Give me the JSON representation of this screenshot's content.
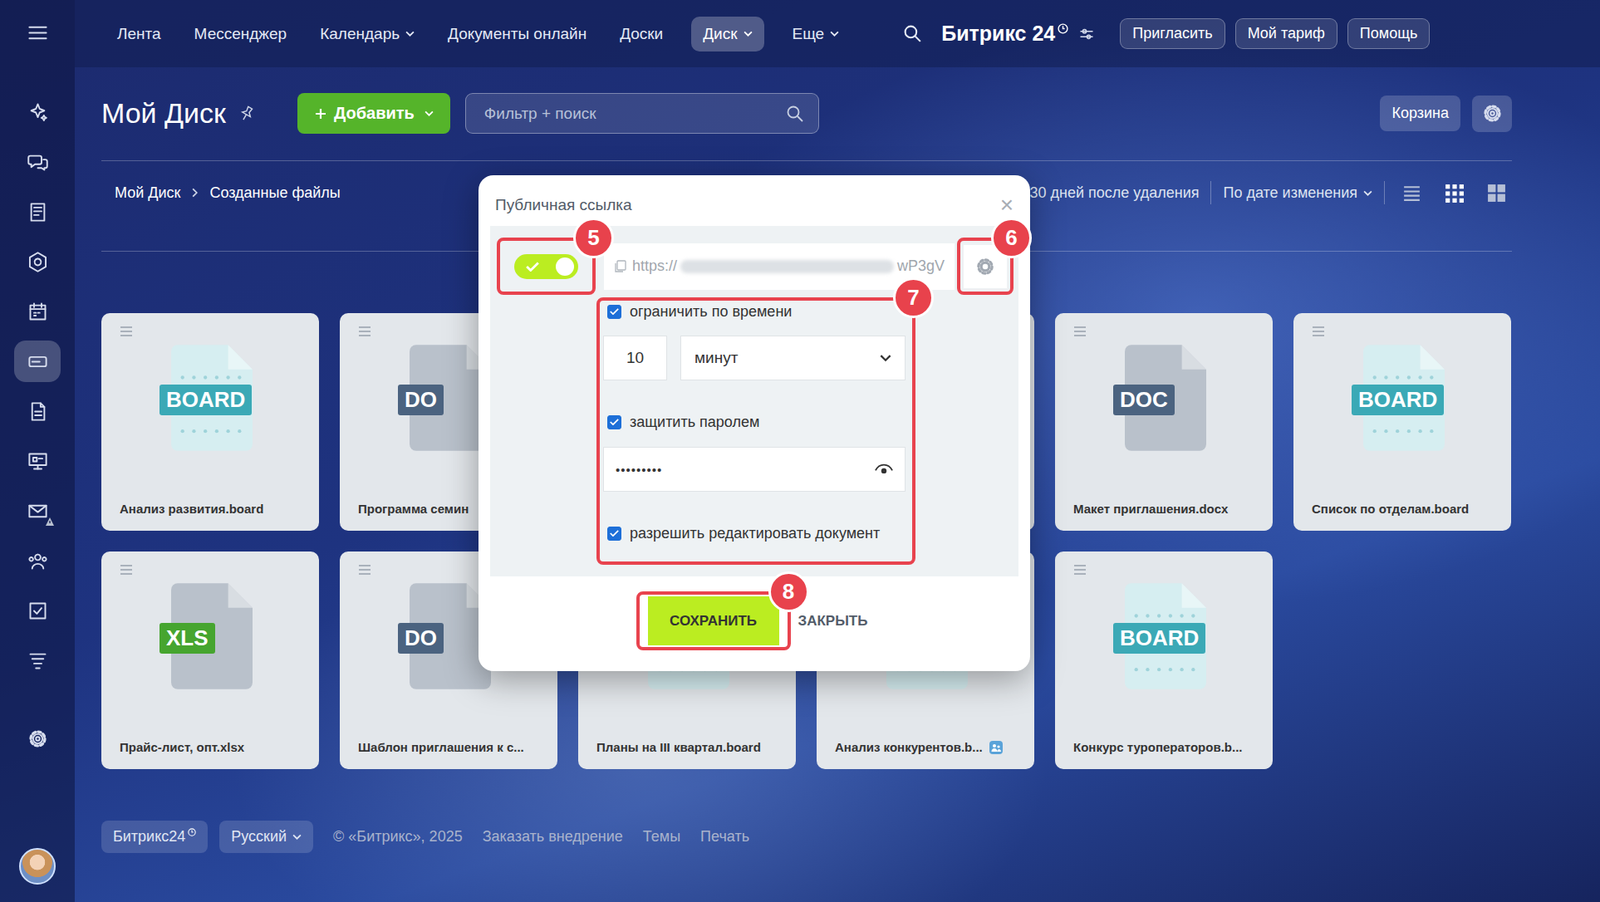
{
  "nav": {
    "items": [
      {
        "label": "Лента",
        "selected": false,
        "dropdown": false
      },
      {
        "label": "Мессенджер",
        "selected": false,
        "dropdown": false
      },
      {
        "label": "Календарь",
        "selected": false,
        "dropdown": true
      },
      {
        "label": "Документы онлайн",
        "selected": false,
        "dropdown": false
      },
      {
        "label": "Доски",
        "selected": false,
        "dropdown": false
      },
      {
        "label": "Диск",
        "selected": true,
        "dropdown": true
      },
      {
        "label": "Еще",
        "selected": false,
        "dropdown": true
      }
    ]
  },
  "logo": {
    "text": "Битрикс 24"
  },
  "header_buttons": [
    "Пригласить",
    "Мой тариф",
    "Помощь"
  ],
  "sidebar": {
    "items": [
      {
        "kind": "copilot",
        "selected": false,
        "alert": false
      },
      {
        "kind": "chats",
        "selected": false,
        "alert": false
      },
      {
        "kind": "feed",
        "selected": false,
        "alert": false
      },
      {
        "kind": "shield",
        "selected": false,
        "alert": false
      },
      {
        "kind": "calendar",
        "selected": false,
        "alert": false
      },
      {
        "kind": "disk",
        "selected": true,
        "alert": false
      },
      {
        "kind": "docs",
        "selected": false,
        "alert": false
      },
      {
        "kind": "screen",
        "selected": false,
        "alert": false
      },
      {
        "kind": "mail",
        "selected": false,
        "alert": true
      },
      {
        "kind": "team",
        "selected": false,
        "alert": false
      },
      {
        "kind": "tasks",
        "selected": false,
        "alert": false
      },
      {
        "kind": "funnel",
        "selected": false,
        "alert": false
      }
    ]
  },
  "page": {
    "title": "Мой Диск",
    "add_button": "Добавить",
    "search_placeholder": "Фильтр + поиск",
    "trash_button": "Корзина"
  },
  "breadcrumbs": [
    "Мой Диск",
    "Созданные файлы"
  ],
  "toolbar": {
    "retention": "30 дней после удаления",
    "sort": "По дате изменения",
    "view_modes": [
      {
        "kind": "list",
        "selected": false
      },
      {
        "kind": "grid",
        "selected": true
      },
      {
        "kind": "tiles",
        "selected": false
      }
    ]
  },
  "files": {
    "row1": [
      {
        "name": "Анализ развития.board",
        "kind": "board",
        "type": "BOARD",
        "shared": false
      },
      {
        "name": "Программа семин",
        "kind": "doc",
        "type": "DO",
        "shared": false
      },
      {
        "name": "Макет приглашения.docx",
        "kind": "doc",
        "type": "DOC",
        "shared": false
      },
      {
        "name": "Список по отделам.board",
        "kind": "board",
        "type": "BOARD",
        "shared": false
      }
    ],
    "row2": [
      {
        "name": "Прайс-лист, опт.xlsx",
        "kind": "xls",
        "type": "XLS",
        "shared": false
      },
      {
        "name": "Шаблон приглашения к с...",
        "kind": "doc",
        "type": "DO",
        "shared": false
      },
      {
        "name": "Планы на III квартал.board",
        "kind": "board",
        "type": "",
        "shared": false
      },
      {
        "name": "Анализ конкурентов.b...",
        "kind": "board",
        "type": "",
        "shared": true
      },
      {
        "name": "Конкурс туроператоров.b...",
        "kind": "board",
        "type": "BOARD",
        "shared": false
      }
    ]
  },
  "footer": {
    "brand": "Битрикс24",
    "language": "Русский",
    "copyright": "© «Битрикс», 2025",
    "links": [
      "Заказать внедрение",
      "Темы",
      "Печать"
    ]
  },
  "dialog": {
    "title": "Публичная ссылка",
    "close": "×",
    "enabled": true,
    "url_start": "https://",
    "url_end": "wP3gV",
    "time": {
      "label": "ограничить по времени",
      "checked": true,
      "amount": "10",
      "unit": "минут"
    },
    "password": {
      "label": "защитить паролем",
      "checked": true,
      "value": "•••••••••"
    },
    "edit": {
      "label": "разрешить редактировать документ",
      "checked": true
    },
    "buttons": [
      {
        "label": "СОХРАНИТЬ",
        "primary": true
      },
      {
        "label": "ЗАКРЫТЬ",
        "primary": false
      }
    ]
  },
  "annotations": {
    "toggle": "5",
    "settings": "6",
    "options": "7",
    "save": "8"
  }
}
